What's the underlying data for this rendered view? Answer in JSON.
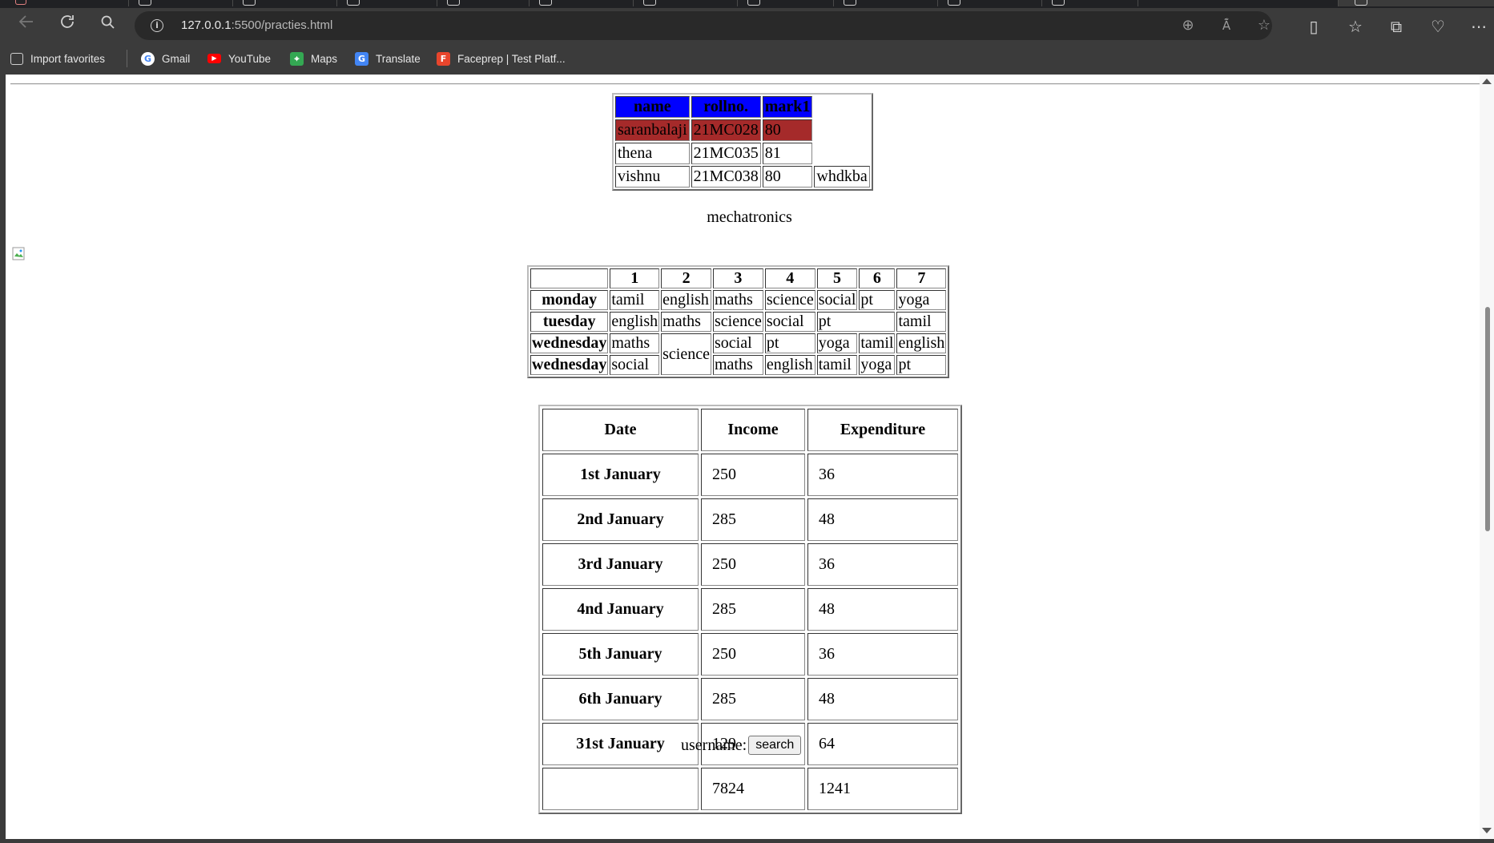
{
  "browser": {
    "url_host": "127.0.0.1",
    "url_rest": ":5500/practies.html",
    "bookmarks": [
      {
        "label": "Import favorites",
        "icon": "import-favorites-icon"
      },
      {
        "label": "Gmail",
        "icon": "google-icon"
      },
      {
        "label": "YouTube",
        "icon": "youtube-icon"
      },
      {
        "label": "Maps",
        "icon": "maps-icon"
      },
      {
        "label": "Translate",
        "icon": "translate-icon"
      },
      {
        "label": "Faceprep | Test Platf...",
        "icon": "faceprep-icon"
      }
    ]
  },
  "students": {
    "headers": [
      "name",
      "rollno.",
      "mark1"
    ],
    "rows": [
      [
        "saranbalaji",
        "21MC028",
        "80"
      ],
      [
        "thena",
        "21MC035",
        "81"
      ],
      [
        "vishnu",
        "21MC038",
        "80",
        "whdkba"
      ]
    ]
  },
  "caption": "mechatronics",
  "timetable": {
    "periods": [
      "1",
      "2",
      "3",
      "4",
      "5",
      "6",
      "7"
    ],
    "days": [
      "monday",
      "tuesday",
      "wednesday",
      "wednesday"
    ],
    "monday": [
      "tamil",
      "english",
      "maths",
      "science",
      "social",
      "pt",
      "yoga"
    ],
    "tuesday": [
      "english",
      "maths",
      "science",
      "social",
      "pt",
      "tamil"
    ],
    "wednesday1": [
      "maths",
      "science",
      "social",
      "pt",
      "yoga",
      "tamil",
      "english"
    ],
    "wednesday2": [
      "social",
      "maths",
      "english",
      "tamil",
      "yoga",
      "pt"
    ]
  },
  "finance": {
    "headers": [
      "Date",
      "Income",
      "Expenditure"
    ],
    "rows": [
      [
        "1st January",
        "250",
        "36"
      ],
      [
        "2nd January",
        "285",
        "48"
      ],
      [
        "3rd January",
        "250",
        "36"
      ],
      [
        "4nd January",
        "285",
        "48"
      ],
      [
        "5th January",
        "250",
        "36"
      ],
      [
        "6th January",
        "285",
        "48"
      ],
      [
        "31st January",
        "129",
        "64"
      ],
      [
        "",
        "7824",
        "1241"
      ]
    ]
  },
  "form": {
    "label": "username:",
    "button": "search"
  }
}
